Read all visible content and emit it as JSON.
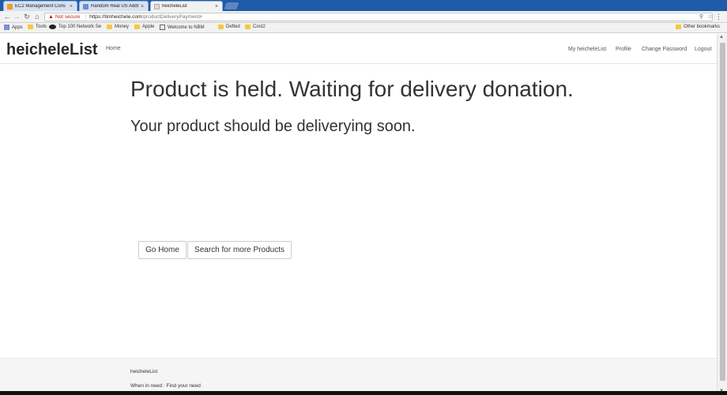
{
  "browser": {
    "tabs": [
      {
        "label": "EC2 Management Cons",
        "favicon_color": "#f29c1f"
      },
      {
        "label": "Random Real US Addre",
        "favicon_color": "#6a8fd1"
      },
      {
        "label": "heicheleList",
        "favicon_color": "#dcdcdc",
        "active": true
      }
    ],
    "close_glyph": "×",
    "omnibox": {
      "security": "Not secure",
      "url_host": "https://timheichele.com",
      "url_path": "/productDeliveryPayment#"
    },
    "bookmarks": [
      {
        "label": "Apps",
        "icon": "apps-icon"
      },
      {
        "label": "Tools",
        "icon": "folder-icon"
      },
      {
        "label": "Top 100 Network Se",
        "icon": "eye-icon"
      },
      {
        "label": "Money",
        "icon": "folder-icon"
      },
      {
        "label": "Apple",
        "icon": "folder-icon"
      },
      {
        "label": "Welcome to NBM",
        "icon": "page-icon"
      },
      {
        "label": "Defted",
        "icon": "folder-icon"
      },
      {
        "label": "Cost2",
        "icon": "folder-icon"
      },
      {
        "label": "Other bookmarks",
        "icon": "folder-icon"
      }
    ]
  },
  "navbar": {
    "brand": "heicheleList",
    "home": "Home",
    "right_links": [
      "My heicheleList",
      "Profile",
      "Change Password",
      "Logout"
    ]
  },
  "main": {
    "heading": "Product is held. Waiting for delivery donation.",
    "subheading": "Your product should be deliverying soon.",
    "buttons": [
      "Go Home",
      "Search for more Products"
    ]
  },
  "footer": {
    "title": "heicheleList",
    "tagline": "When in need : Find your need"
  },
  "colors": {
    "tabstrip": "#1e5ba8",
    "text": "#333333",
    "footer_bg": "#f5f5f5"
  }
}
